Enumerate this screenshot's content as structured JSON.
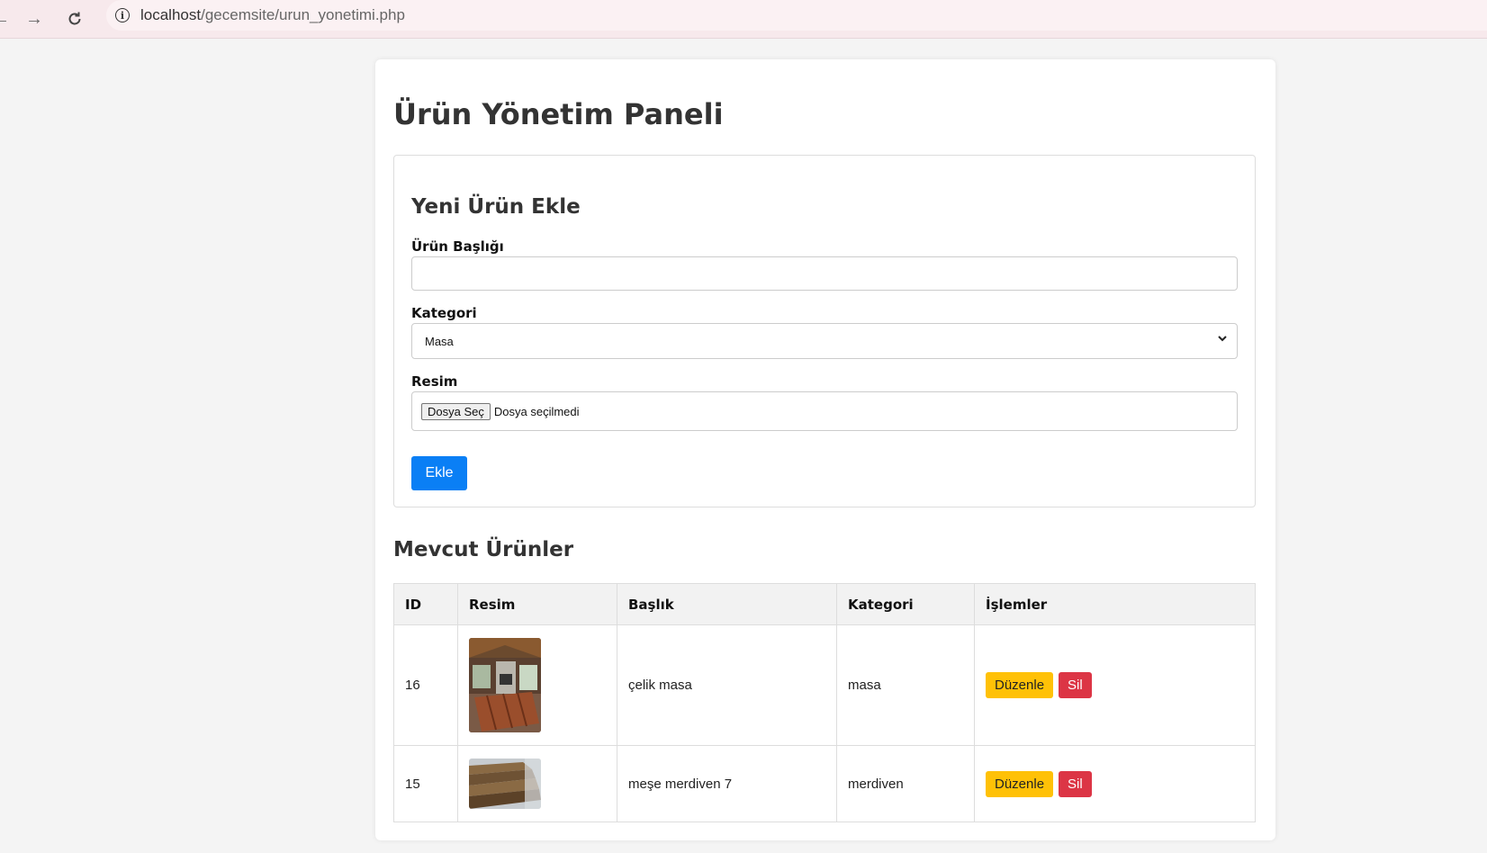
{
  "browser": {
    "url_host": "localhost",
    "url_path": "/gecemsite/urun_yonetimi.php"
  },
  "page": {
    "title": "Ürün Yönetim Paneli"
  },
  "form": {
    "title": "Yeni Ürün Ekle",
    "title_label": "Ürün Başlığı",
    "title_value": "",
    "category_label": "Kategori",
    "category_selected": "Masa",
    "image_label": "Resim",
    "file_button": "Dosya Seç",
    "file_status": "Dosya seçilmedi",
    "submit_label": "Ekle"
  },
  "list": {
    "title": "Mevcut Ürünler",
    "headers": [
      "ID",
      "Resim",
      "Başlık",
      "Kategori",
      "İşlemler"
    ],
    "rows": [
      {
        "id": "16",
        "title": "çelik masa",
        "category": "masa",
        "edit_label": "Düzenle",
        "delete_label": "Sil"
      },
      {
        "id": "15",
        "title": "meşe merdiven 7",
        "category": "merdiven",
        "edit_label": "Düzenle",
        "delete_label": "Sil"
      }
    ]
  },
  "colors": {
    "primary": "#0a7ff5",
    "warning": "#ffc107",
    "danger": "#dc3545"
  }
}
